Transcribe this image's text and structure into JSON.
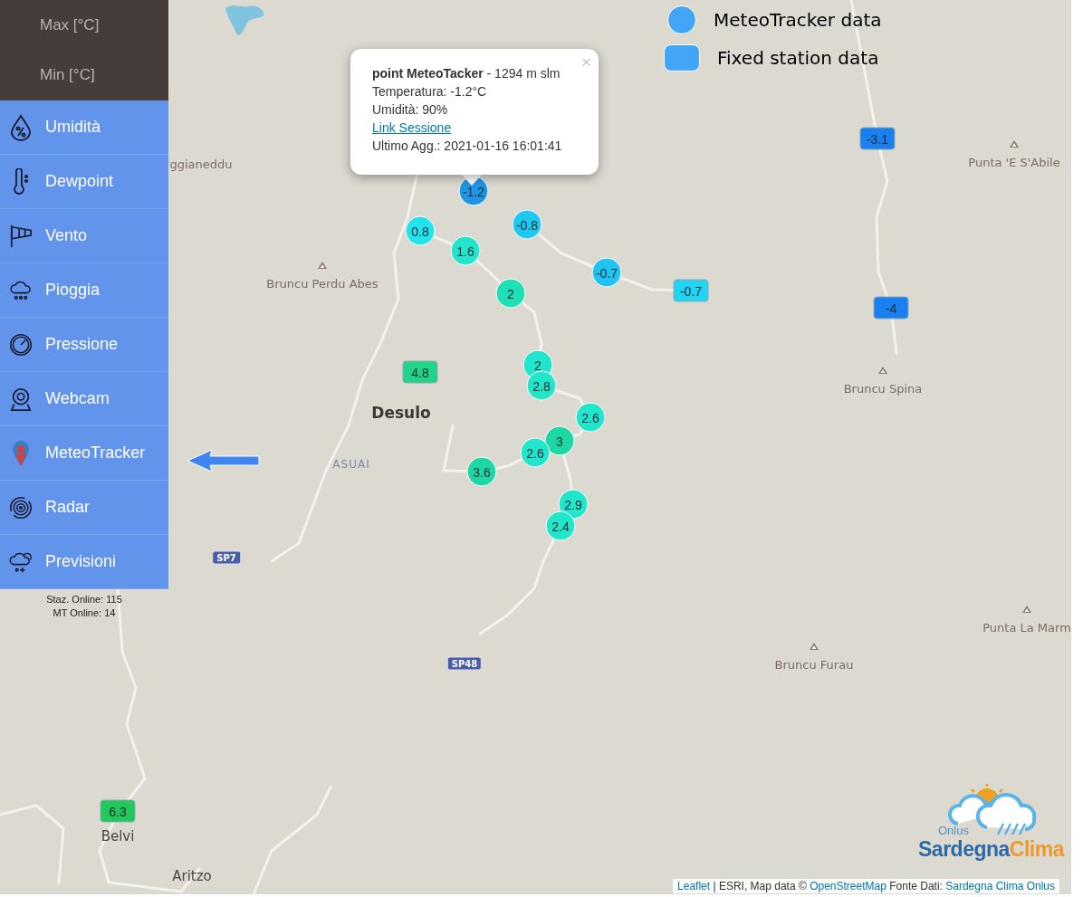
{
  "sidebar": {
    "temperature_items": [
      "Max [°C]",
      "Min [°C]"
    ],
    "items": [
      {
        "label": "Umidità"
      },
      {
        "label": "Dewpoint"
      },
      {
        "label": "Vento"
      },
      {
        "label": "Pioggia"
      },
      {
        "label": "Pressione"
      },
      {
        "label": "Webcam"
      },
      {
        "label": "MeteoTracker"
      },
      {
        "label": "Radar"
      },
      {
        "label": "Previsioni"
      }
    ],
    "stats": [
      "Staz. Online: 115",
      "MT Online: 14"
    ]
  },
  "legend": [
    {
      "kind": "circle",
      "label": "MeteoTracker data"
    },
    {
      "kind": "square",
      "label": "Fixed station data"
    }
  ],
  "places": [
    {
      "kind": "partial",
      "text": "ggianeddu"
    },
    {
      "kind": "peak",
      "text": "Bruncu Perdu Abes"
    },
    {
      "kind": "peak",
      "text": "Punta 'E S'Abile"
    },
    {
      "kind": "peak",
      "text": "Bruncu Spina"
    },
    {
      "kind": "town",
      "text": "Desulo"
    },
    {
      "kind": "locality",
      "text": "ASUAI"
    },
    {
      "kind": "peak",
      "text": "Bruncu Furau"
    },
    {
      "kind": "peak",
      "text": "Punta La Marm"
    },
    {
      "kind": "village",
      "text": "Belvi"
    },
    {
      "kind": "village",
      "text": "Aritzo"
    },
    {
      "kind": "road",
      "text": "SP7"
    },
    {
      "kind": "road",
      "text": "SP48"
    }
  ],
  "markers": [
    {
      "kind": "tracker",
      "value": "-1.2",
      "color": "#1e96e6"
    },
    {
      "kind": "tracker",
      "value": "0.8",
      "color": "#22e4ec"
    },
    {
      "kind": "tracker",
      "value": "-0.8",
      "color": "#1ec8f0"
    },
    {
      "kind": "tracker",
      "value": "1.6",
      "color": "#22e6cc"
    },
    {
      "kind": "tracker",
      "value": "2",
      "color": "#1ee0b4"
    },
    {
      "kind": "tracker",
      "value": "-0.7",
      "color": "#20c4f2"
    },
    {
      "kind": "tracker",
      "value": "2",
      "color": "#22e6cc"
    },
    {
      "kind": "tracker",
      "value": "2.8",
      "color": "#22e6cc"
    },
    {
      "kind": "tracker",
      "value": "2.6",
      "color": "#22e6cc"
    },
    {
      "kind": "tracker",
      "value": "3",
      "color": "#1ed8a4"
    },
    {
      "kind": "tracker",
      "value": "2.6",
      "color": "#22e6cc"
    },
    {
      "kind": "tracker",
      "value": "3.6",
      "color": "#1ed8a4"
    },
    {
      "kind": "tracker",
      "value": "2.9",
      "color": "#22e6cc"
    },
    {
      "kind": "tracker",
      "value": "2.4",
      "color": "#22e6cc"
    },
    {
      "kind": "station",
      "value": "-3.1",
      "color": "#1a80f0"
    },
    {
      "kind": "station",
      "value": "-0.7",
      "color": "#20d4f2"
    },
    {
      "kind": "station",
      "value": "-4",
      "color": "#1a80f0"
    },
    {
      "kind": "station",
      "value": "4.8",
      "color": "#22d488"
    },
    {
      "kind": "station",
      "value": "6.3",
      "color": "#22c85a"
    }
  ],
  "popup": {
    "title": "**point MeteoTacker** - 1294 m slm",
    "close": "×",
    "lines": [
      {
        "kind": "text",
        "text": "Temperatura: -1.2°C"
      },
      {
        "kind": "text",
        "text": "Umidità: 90%"
      },
      {
        "kind": "link",
        "text": "Link Sessione"
      },
      {
        "kind": "text",
        "text": "Ultimo Agg.: 2021-01-16 16:01:41"
      }
    ]
  },
  "logo": {
    "tagline": "Onlus",
    "words": [
      "Sardegna",
      "Clima"
    ]
  },
  "attribution": [
    {
      "kind": "link",
      "text": "Leaflet"
    },
    {
      "kind": "text",
      "text": "| ESRI, Map data ©"
    },
    {
      "kind": "link",
      "text": "OpenStreetMap"
    },
    {
      "kind": "text",
      "text": "Fonte Dati:"
    },
    {
      "kind": "link",
      "text": "Sardegna Clima Onlus"
    }
  ]
}
